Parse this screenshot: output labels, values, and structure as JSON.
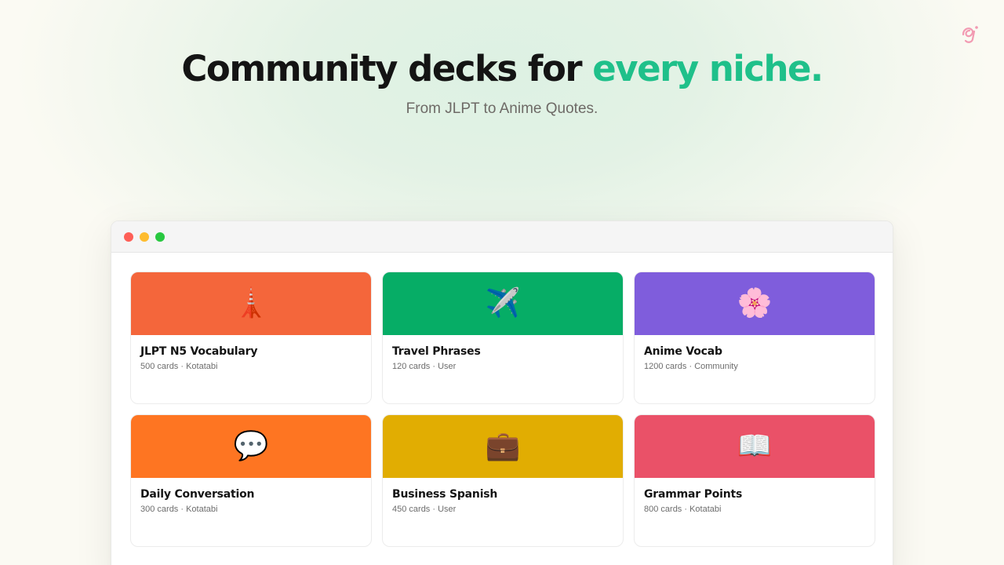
{
  "hero": {
    "headline_main": "Community decks for ",
    "headline_accent": "every niche.",
    "subtitle": "From JLPT to Anime Quotes."
  },
  "colors": {
    "accent": "#1fc08a",
    "background": "#fbfaf3",
    "logo": "#f29ab2"
  },
  "window": {
    "controls": [
      "close",
      "minimize",
      "maximize"
    ]
  },
  "decks": [
    {
      "title": "JLPT N5 Vocabulary",
      "meta": "500 cards · Kotatabi",
      "icon": "🗼",
      "icon_name": "tokyo-tower-icon",
      "color": "#f4663b"
    },
    {
      "title": "Travel Phrases",
      "meta": "120 cards · User",
      "icon": "✈️",
      "icon_name": "airplane-icon",
      "color": "#06ad66"
    },
    {
      "title": "Anime Vocab",
      "meta": "1200 cards · Community",
      "icon": "🌸",
      "icon_name": "cherry-blossom-icon",
      "color": "#7f5ddc"
    },
    {
      "title": "Daily Conversation",
      "meta": "300 cards · Kotatabi",
      "icon": "💬",
      "icon_name": "speech-bubble-icon",
      "color": "#fe7522"
    },
    {
      "title": "Business Spanish",
      "meta": "450 cards · User",
      "icon": "💼",
      "icon_name": "briefcase-icon",
      "color": "#e1ad02"
    },
    {
      "title": "Grammar Points",
      "meta": "800 cards · Kotatabi",
      "icon": "📖",
      "icon_name": "open-book-icon",
      "color": "#ea5168"
    }
  ]
}
